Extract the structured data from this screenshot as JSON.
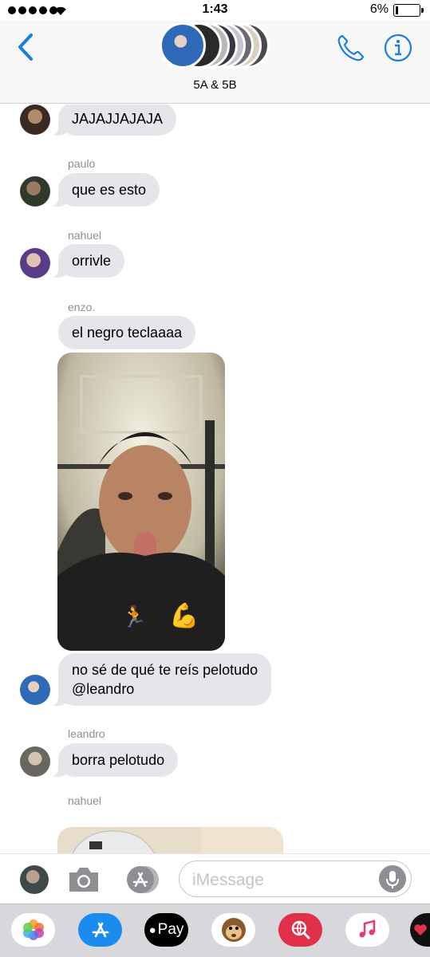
{
  "status_bar": {
    "time": "1:43",
    "battery": "6%"
  },
  "header": {
    "group_name": "5A & 5B"
  },
  "messages": [
    {
      "text": "JAJAJJAJAJA"
    },
    {
      "sender": "paulo",
      "text": "que es esto"
    },
    {
      "sender": "nahuel",
      "text": "orrivle"
    },
    {
      "sender": "enzo.",
      "text": "el negro teclaaaa"
    },
    {
      "text_line1": "no sé de qué te reís pelotudo",
      "text_line2": "@leandro"
    },
    {
      "sender": "leandro",
      "text": "borra pelotudo"
    },
    {
      "sender": "nahuel"
    }
  ],
  "composer": {
    "placeholder": "iMessage"
  },
  "app_drawer": {
    "apple_pay_label": "Pay"
  },
  "colors": {
    "accent": "#1a7ee0",
    "bubble": "#e5e5ea",
    "drawer": "#d8d8dc"
  }
}
